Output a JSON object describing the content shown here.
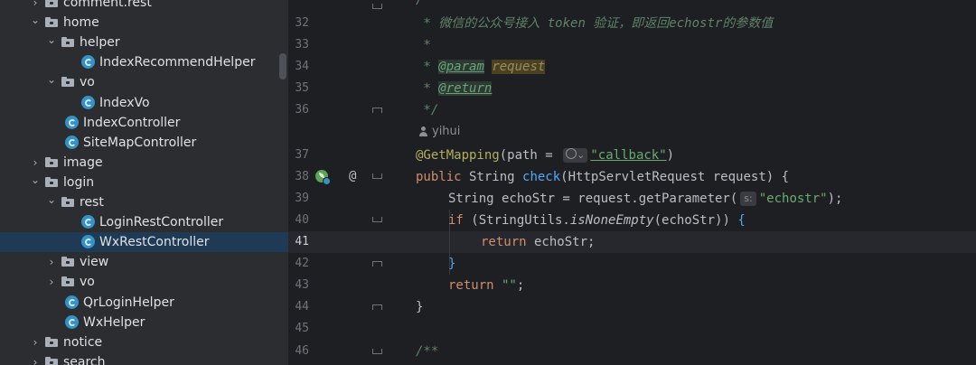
{
  "project_tree": {
    "items": [
      {
        "label": "comment.rest",
        "type": "folder",
        "depth": 1,
        "expanded": false,
        "selected": false
      },
      {
        "label": "home",
        "type": "folder",
        "depth": 1,
        "expanded": true,
        "selected": false
      },
      {
        "label": "helper",
        "type": "folder",
        "depth": 2,
        "expanded": true,
        "selected": false
      },
      {
        "label": "IndexRecommendHelper",
        "type": "class",
        "depth": 3,
        "selected": false
      },
      {
        "label": "vo",
        "type": "folder",
        "depth": 2,
        "expanded": true,
        "selected": false
      },
      {
        "label": "IndexVo",
        "type": "class",
        "depth": 3,
        "selected": false
      },
      {
        "label": "IndexController",
        "type": "class",
        "depth": 2,
        "selected": false
      },
      {
        "label": "SiteMapController",
        "type": "class",
        "depth": 2,
        "selected": false
      },
      {
        "label": "image",
        "type": "folder",
        "depth": 1,
        "expanded": false,
        "selected": false
      },
      {
        "label": "login",
        "type": "folder",
        "depth": 1,
        "expanded": true,
        "selected": false
      },
      {
        "label": "rest",
        "type": "folder",
        "depth": 2,
        "expanded": true,
        "selected": false
      },
      {
        "label": "LoginRestController",
        "type": "class",
        "depth": 3,
        "selected": false
      },
      {
        "label": "WxRestController",
        "type": "class",
        "depth": 3,
        "selected": true
      },
      {
        "label": "view",
        "type": "folder",
        "depth": 2,
        "expanded": false,
        "selected": false
      },
      {
        "label": "vo",
        "type": "folder",
        "depth": 2,
        "expanded": false,
        "selected": false
      },
      {
        "label": "QrLoginHelper",
        "type": "class",
        "depth": 2,
        "selected": false
      },
      {
        "label": "WxHelper",
        "type": "class",
        "depth": 2,
        "selected": false
      },
      {
        "label": "notice",
        "type": "folder",
        "depth": 1,
        "expanded": false,
        "selected": false
      },
      {
        "label": "search",
        "type": "folder",
        "depth": 1,
        "expanded": false,
        "selected": false
      }
    ]
  },
  "editor": {
    "current_line": "41",
    "author_hint": "yihui",
    "line_numbers": [
      "32",
      "33",
      "34",
      "35",
      "36",
      "37",
      "38",
      "39",
      "40",
      "41",
      "42",
      "43",
      "44",
      "45",
      "46"
    ],
    "lines": {
      "l31": "/**",
      "l32_prefix": " * ",
      "l32_text": "微信的公众号接入 token 验证，即返回echostr的参数值",
      "l33": " *",
      "l34_prefix": " * ",
      "l34_tag": "@param",
      "l34_name": "request",
      "l35_prefix": " * ",
      "l35_tag": "@return",
      "l36": " */",
      "l37_ann": "@GetMapping",
      "l37_open": "(path = ",
      "l37_str": "\"callback\"",
      "l37_close": ")",
      "l38_kw": "public",
      "l38_type": " String ",
      "l38_fn": "check",
      "l38_params": "(HttpServletRequest request) {",
      "l39_a": "String echoStr = request.getParameter(",
      "l39_hint": "s:",
      "l39_str": "\"echostr\"",
      "l39_end": ");",
      "l40_kw": "if",
      "l40_a": " (StringUtils.",
      "l40_static": "isNoneEmpty",
      "l40_b": "(echoStr)) ",
      "l40_brace": "{",
      "l41_kw": "return",
      "l41_rest": " echoStr;",
      "l42_brace": "}",
      "l43_kw": "return",
      "l43_str": " \"\"",
      "l43_end": ";",
      "l44": "}",
      "l46": "/**"
    }
  },
  "icons": {
    "folder": "folder-icon",
    "class": "java-class-icon",
    "expand": "chevron-icon",
    "spring_bean": "spring-bean-icon",
    "annotation_marker": "at-icon",
    "author": "person-icon"
  },
  "colors": {
    "selected_row": "#1f3a55",
    "class_icon": "#3592c4",
    "keyword": "#cf8e6d",
    "annotation": "#b3ae60",
    "string": "#6aab73",
    "method": "#56a8f5",
    "doc_comment": "#5f826b"
  }
}
